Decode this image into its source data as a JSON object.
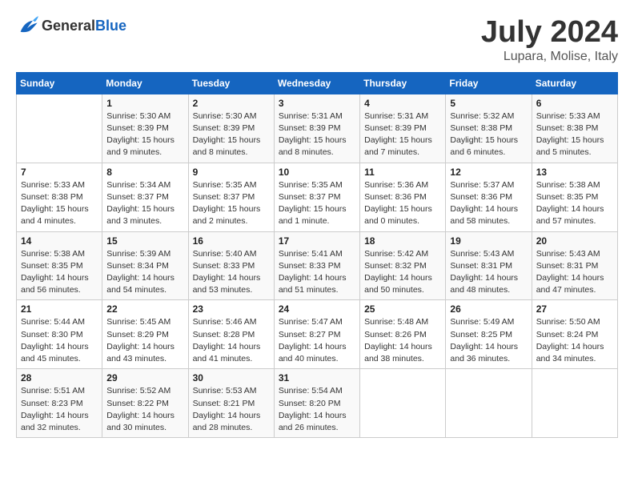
{
  "header": {
    "logo_general": "General",
    "logo_blue": "Blue",
    "month": "July 2024",
    "location": "Lupara, Molise, Italy"
  },
  "weekdays": [
    "Sunday",
    "Monday",
    "Tuesday",
    "Wednesday",
    "Thursday",
    "Friday",
    "Saturday"
  ],
  "weeks": [
    [
      {
        "day": "",
        "info": ""
      },
      {
        "day": "1",
        "info": "Sunrise: 5:30 AM\nSunset: 8:39 PM\nDaylight: 15 hours\nand 9 minutes."
      },
      {
        "day": "2",
        "info": "Sunrise: 5:30 AM\nSunset: 8:39 PM\nDaylight: 15 hours\nand 8 minutes."
      },
      {
        "day": "3",
        "info": "Sunrise: 5:31 AM\nSunset: 8:39 PM\nDaylight: 15 hours\nand 8 minutes."
      },
      {
        "day": "4",
        "info": "Sunrise: 5:31 AM\nSunset: 8:39 PM\nDaylight: 15 hours\nand 7 minutes."
      },
      {
        "day": "5",
        "info": "Sunrise: 5:32 AM\nSunset: 8:38 PM\nDaylight: 15 hours\nand 6 minutes."
      },
      {
        "day": "6",
        "info": "Sunrise: 5:33 AM\nSunset: 8:38 PM\nDaylight: 15 hours\nand 5 minutes."
      }
    ],
    [
      {
        "day": "7",
        "info": "Sunrise: 5:33 AM\nSunset: 8:38 PM\nDaylight: 15 hours\nand 4 minutes."
      },
      {
        "day": "8",
        "info": "Sunrise: 5:34 AM\nSunset: 8:37 PM\nDaylight: 15 hours\nand 3 minutes."
      },
      {
        "day": "9",
        "info": "Sunrise: 5:35 AM\nSunset: 8:37 PM\nDaylight: 15 hours\nand 2 minutes."
      },
      {
        "day": "10",
        "info": "Sunrise: 5:35 AM\nSunset: 8:37 PM\nDaylight: 15 hours\nand 1 minute."
      },
      {
        "day": "11",
        "info": "Sunrise: 5:36 AM\nSunset: 8:36 PM\nDaylight: 15 hours\nand 0 minutes."
      },
      {
        "day": "12",
        "info": "Sunrise: 5:37 AM\nSunset: 8:36 PM\nDaylight: 14 hours\nand 58 minutes."
      },
      {
        "day": "13",
        "info": "Sunrise: 5:38 AM\nSunset: 8:35 PM\nDaylight: 14 hours\nand 57 minutes."
      }
    ],
    [
      {
        "day": "14",
        "info": "Sunrise: 5:38 AM\nSunset: 8:35 PM\nDaylight: 14 hours\nand 56 minutes."
      },
      {
        "day": "15",
        "info": "Sunrise: 5:39 AM\nSunset: 8:34 PM\nDaylight: 14 hours\nand 54 minutes."
      },
      {
        "day": "16",
        "info": "Sunrise: 5:40 AM\nSunset: 8:33 PM\nDaylight: 14 hours\nand 53 minutes."
      },
      {
        "day": "17",
        "info": "Sunrise: 5:41 AM\nSunset: 8:33 PM\nDaylight: 14 hours\nand 51 minutes."
      },
      {
        "day": "18",
        "info": "Sunrise: 5:42 AM\nSunset: 8:32 PM\nDaylight: 14 hours\nand 50 minutes."
      },
      {
        "day": "19",
        "info": "Sunrise: 5:43 AM\nSunset: 8:31 PM\nDaylight: 14 hours\nand 48 minutes."
      },
      {
        "day": "20",
        "info": "Sunrise: 5:43 AM\nSunset: 8:31 PM\nDaylight: 14 hours\nand 47 minutes."
      }
    ],
    [
      {
        "day": "21",
        "info": "Sunrise: 5:44 AM\nSunset: 8:30 PM\nDaylight: 14 hours\nand 45 minutes."
      },
      {
        "day": "22",
        "info": "Sunrise: 5:45 AM\nSunset: 8:29 PM\nDaylight: 14 hours\nand 43 minutes."
      },
      {
        "day": "23",
        "info": "Sunrise: 5:46 AM\nSunset: 8:28 PM\nDaylight: 14 hours\nand 41 minutes."
      },
      {
        "day": "24",
        "info": "Sunrise: 5:47 AM\nSunset: 8:27 PM\nDaylight: 14 hours\nand 40 minutes."
      },
      {
        "day": "25",
        "info": "Sunrise: 5:48 AM\nSunset: 8:26 PM\nDaylight: 14 hours\nand 38 minutes."
      },
      {
        "day": "26",
        "info": "Sunrise: 5:49 AM\nSunset: 8:25 PM\nDaylight: 14 hours\nand 36 minutes."
      },
      {
        "day": "27",
        "info": "Sunrise: 5:50 AM\nSunset: 8:24 PM\nDaylight: 14 hours\nand 34 minutes."
      }
    ],
    [
      {
        "day": "28",
        "info": "Sunrise: 5:51 AM\nSunset: 8:23 PM\nDaylight: 14 hours\nand 32 minutes."
      },
      {
        "day": "29",
        "info": "Sunrise: 5:52 AM\nSunset: 8:22 PM\nDaylight: 14 hours\nand 30 minutes."
      },
      {
        "day": "30",
        "info": "Sunrise: 5:53 AM\nSunset: 8:21 PM\nDaylight: 14 hours\nand 28 minutes."
      },
      {
        "day": "31",
        "info": "Sunrise: 5:54 AM\nSunset: 8:20 PM\nDaylight: 14 hours\nand 26 minutes."
      },
      {
        "day": "",
        "info": ""
      },
      {
        "day": "",
        "info": ""
      },
      {
        "day": "",
        "info": ""
      }
    ]
  ]
}
